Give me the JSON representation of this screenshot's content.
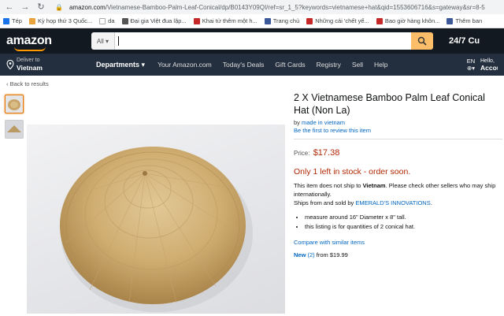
{
  "browser": {
    "url_host": "amazon.com",
    "url_path": "/Vietnamese-Bamboo-Palm-Leaf-Conical/dp/B0143Y09QI/ref=sr_1_5?keywords=vietnamese+hat&qid=1553606716&s=gateway&sr=8-5"
  },
  "bookmarks": [
    {
      "label": "Tép",
      "icon": "apps-icon",
      "color": "#1a73e8"
    },
    {
      "label": "Kỳ họp thứ 3 Quốc...",
      "icon": "star-icon",
      "color": "#e8a33c"
    },
    {
      "label": "da",
      "icon": "page-icon",
      "color": "#ffffff"
    },
    {
      "label": "Đại gia Việt đua lập...",
      "icon": "news-icon",
      "color": "#555555"
    },
    {
      "label": "Khai tử thêm một h...",
      "icon": "news-icon",
      "color": "#c62828"
    },
    {
      "label": "Trang chủ",
      "icon": "facebook-icon",
      "color": "#3b5998"
    },
    {
      "label": "Những cái 'chết yể...",
      "icon": "news-icon",
      "color": "#c62828"
    },
    {
      "label": "Bao giờ hàng khôn...",
      "icon": "news-icon",
      "color": "#c62828"
    },
    {
      "label": "Thêm ban",
      "icon": "facebook-icon",
      "color": "#3b5998"
    }
  ],
  "amazon": {
    "logo": "amazon",
    "search_category": "All",
    "search_value": "",
    "promo": "24/7 Cu",
    "deliver_small": "Deliver to",
    "deliver_big": "Vietnam",
    "departments": "Departments",
    "nav": [
      "Your Amazon.com",
      "Today's Deals",
      "Gift Cards",
      "Registry",
      "Sell",
      "Help"
    ],
    "lang": "EN",
    "hello": "Hello,",
    "account": "Accou"
  },
  "page": {
    "back": "‹ Back to results",
    "title": "2 X Vietnamese Bamboo Palm Leaf Conical Hat (Non La)",
    "by_prefix": "by",
    "brand": "made in vietnam",
    "review": "Be the first to review this item",
    "price_label": "Price:",
    "price": "$17.38",
    "stock": "Only 1 left in stock - order soon.",
    "ship_1a": "This item does not ship to",
    "ship_1b": "Vietnam",
    "ship_1c": ". Please check other sellers who may ship internationally.",
    "ship_2a": "Ships from and sold by",
    "ship_2b": "EMERALD'S INNOVATIONS",
    "ship_2c": ".",
    "bullets": [
      "measure around 16\" Diameter x 8\" tall.",
      "this listing is for quantities of 2 conical hat."
    ],
    "compare": "Compare with similar items",
    "new_label": "New",
    "new_count": "(2)",
    "new_from": "from $19.99"
  },
  "colors": {
    "amazon_dark": "#131921",
    "amazon_nav": "#232f3e",
    "accent": "#ff9900",
    "price": "#b12704",
    "link": "#0066c0"
  }
}
